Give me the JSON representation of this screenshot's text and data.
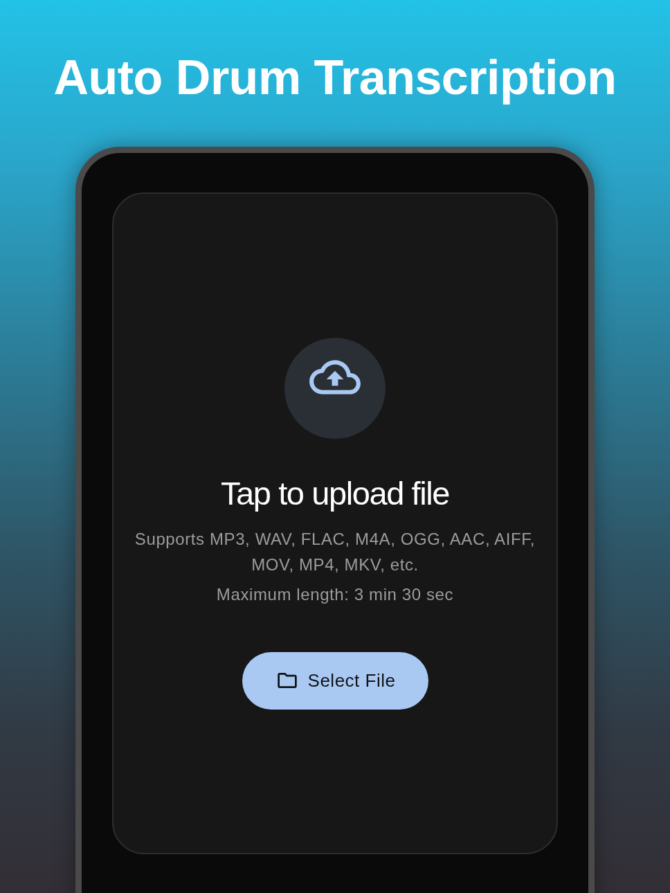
{
  "title": "Auto Drum Transcription",
  "upload_card": {
    "heading": "Tap to upload file",
    "formats": "Supports MP3, WAV, FLAC, M4A, OGG, AAC, AIFF, MOV, MP4, MKV, etc.",
    "limit": "Maximum length: 3 min 30 sec",
    "button": {
      "label": "Select File"
    }
  }
}
